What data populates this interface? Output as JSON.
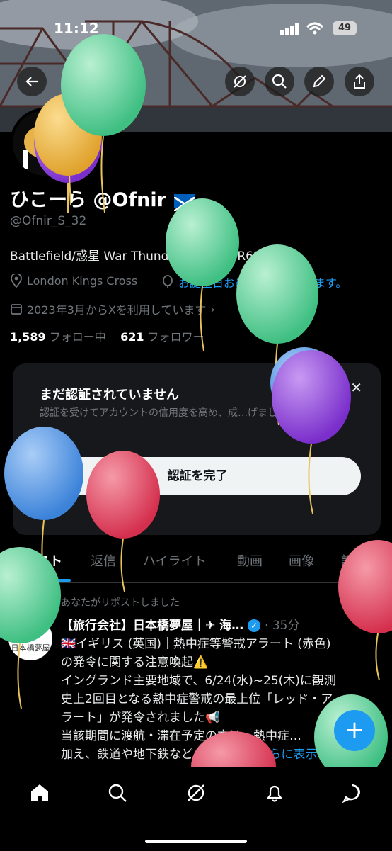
{
  "status_bar": {
    "time": "11:12",
    "battery": "49"
  },
  "profile": {
    "display_name": "ひこーら @Ofnir",
    "handle": "@Ofnir_S_32",
    "bio": "Battlefield/惑星 War Thunder/ゼンゼロ/R6Sに生息",
    "location": "London Kings Cross",
    "birthday_text": "お誕生日おめでとうございます。",
    "joined": "2023年3月からXを利用しています",
    "following_count": "1,589",
    "following_label": "フォロー中",
    "followers_count": "621",
    "followers_label": "フォロワー"
  },
  "verify_card": {
    "title": "まだ認証されていません",
    "description": "認証を受けてアカウントの信用度を高め、成…げましょう。",
    "button": "認証を完了"
  },
  "tabs": [
    "ポスト",
    "返信",
    "ハイライト",
    "動画",
    "画像",
    "記事"
  ],
  "post": {
    "repost_label": "あなたがリポストしました",
    "author": "【旅行会社】日本橋夢屋｜✈ 海…",
    "time": "· 35分",
    "avatar_text": "日本橋夢屋",
    "line1": "🇬🇧イギリス (英国)｜熱中症等警戒アラート (赤色)",
    "line2": "の発令に関する注意喚起⚠️",
    "line3": "イングランド主要地域で、6/24(水)~25(木)に観測",
    "line4": "史上2回目となる熱中症警戒の最上位「レッド・ア",
    "line5": "ラート」が発令されました📢",
    "line6": "当該期間に渡航・滞在予定の方は、熱中症…",
    "line7": "加え、鉄道や地下鉄など公共交通機",
    "more": "さらに表示"
  },
  "fab_label": "+",
  "colors": {
    "accent": "#1d9bf0",
    "balloon_green": "#5fd39a",
    "balloon_purple": "#8a3fd6",
    "balloon_red": "#e0405c",
    "balloon_blue": "#4a90e2",
    "balloon_yellow": "#f0b63a"
  }
}
